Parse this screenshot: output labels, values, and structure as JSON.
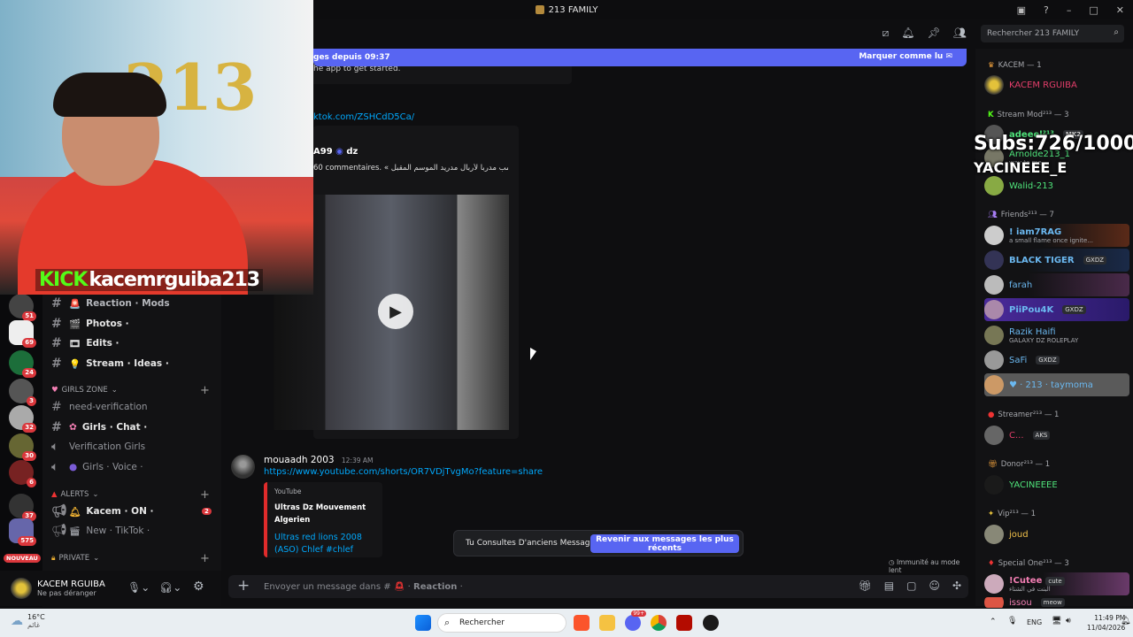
{
  "window": {
    "title": "213 FAMILY"
  },
  "header": {
    "search_placeholder": "Rechercher 213 FAMILY"
  },
  "new_messages_bar": {
    "text": "ges depuis 09:37",
    "mark_read": "Marquer comme lu"
  },
  "messages": {
    "fragment_text": "he app to get started.",
    "tiktok_link": "ktok.com/ZSHCdD5Ca/",
    "embed_author": "A99",
    "embed_flag": "dz",
    "embed_description": "60 commentaires. « ديدي ديشامب مدرباً لأربال مدريد الموسم المقبل",
    "msg2_author": "mouaadh 2003",
    "msg2_time": "12:39 AM",
    "msg2_link": "https://www.youtube.com/shorts/OR7VDjTvgMo?feature=share",
    "yt_provider": "YouTube",
    "yt_channel": "Ultras Dz Mouvement Algerien",
    "yt_title": "Ultras red lions 2008 (ASO) Chlef #chlef"
  },
  "old_notice": {
    "text": "Tu Consultes D'anciens Messages",
    "button": "Revenir aux messages les plus récents"
  },
  "immunity": "Immunité au mode lent",
  "composer": {
    "placeholder_prefix": "Envoyer un message dans #",
    "channel": "Reaction"
  },
  "channels": {
    "items": [
      {
        "label": "Reaction · Mods",
        "emoji": "🚨"
      },
      {
        "label": "Photos ·",
        "emoji": "🎬"
      },
      {
        "label": "Edits ·",
        "emoji": "🎞"
      },
      {
        "label": "Stream · Ideas ·",
        "emoji": "💡"
      }
    ],
    "girls_zone": "GIRLS ZONE",
    "need_verification": "need-verification",
    "girls_chat": "Girls · Chat ·",
    "verification_girls": "Verification Girls",
    "girls_voice": "Girls · Voice ·",
    "alerts": "ALERTS",
    "kacem_on": "Kacem · ON ·",
    "kacem_on_badge": "2",
    "new_tiktok": "New · TikTok ·",
    "private": "Private"
  },
  "servers": {
    "badges": [
      "51",
      "69",
      "24",
      "3",
      "32",
      "30",
      "6",
      "37",
      "575"
    ],
    "new_label": "NOUVEAU"
  },
  "user": {
    "name": "KACEM RGUIBA",
    "status": "Ne pas déranger"
  },
  "members": {
    "kacem_cat": "KACEM — 1",
    "kacem": "KACEM RGUIBA",
    "streammod_cat": "Stream Mod²¹³ — 3",
    "mod1": "adeeel²¹³",
    "mod1_tag": "MK2",
    "mod2": "Arnolde213_1",
    "mod2_sub": "way to me",
    "mod3": "Walid-213",
    "friends_cat": "Friends²¹³ — 7",
    "f1": "! iam7RAG",
    "f1_sub": "a small flame once ignite...",
    "f2": "BLACK TIGER",
    "f2_tag": "GXDZ",
    "f3": "farah",
    "f4": "PiiPou4K",
    "f4_tag": "GXDZ",
    "f5": "Razik Haifi",
    "f5_sub": "GALAXY DZ ROLEPLAY",
    "f6": "SaFi",
    "f6_tag": "GXDZ",
    "f7": "♥ · 213 · taymoma",
    "streamer_cat": "Streamer²¹³ — 1",
    "s1": "C...",
    "s1_tag": "AKS",
    "donor_cat": "Donor²¹³ — 1",
    "d1": "YACINEEEE",
    "vip_cat": "Vip²¹³ — 1",
    "v1": "joud",
    "special_cat": "Special One²¹³ — 3",
    "sp1": "!Cutee",
    "sp1_tag": "cute",
    "sp1_sub": "البنت في الشتاء",
    "sp2": "issou",
    "sp2_tag": "meow"
  },
  "overlay": {
    "subs": "Subs:726/1000",
    "name": "YACINEEE_E",
    "kick": "KICK",
    "channel": "kacemrguiba213",
    "cam_text": "213"
  },
  "taskbar": {
    "weather_temp": "16°C",
    "weather_text": "غائم",
    "search": "Rechercher",
    "lang": "ENG",
    "time": "11:49 PM",
    "date": "11/04/2026",
    "discord_badge": "99+"
  }
}
